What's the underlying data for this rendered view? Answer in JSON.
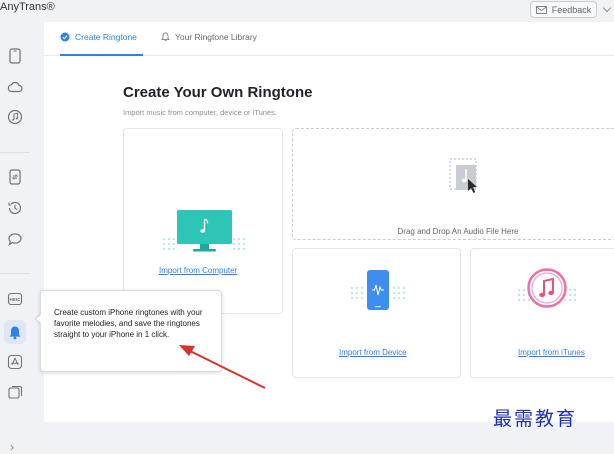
{
  "app": {
    "name": "AnyTrans®"
  },
  "header": {
    "feedback_label": "Feedback"
  },
  "sidebar": {
    "icons": [
      "device-icon",
      "cloud-icon",
      "music-icon",
      "phone-transfer-icon",
      "history-icon",
      "messages-icon",
      "heic-icon",
      "ringtone-icon",
      "app-store-icon",
      "screen-mirror-icon"
    ],
    "active": "ringtone-icon"
  },
  "tabs": [
    {
      "label": "Create Ringtone",
      "active": true
    },
    {
      "label": "Your Ringtone Library",
      "active": false
    }
  ],
  "content": {
    "title": "Create Your Own Ringtone",
    "subtitle": "Import music from computer, device or iTunes.",
    "drop_zone": "Drag and Drop An Audio File Here",
    "import_computer": "Import from Computer",
    "import_device": "Import from Device",
    "import_itunes": "Import from iTunes"
  },
  "tooltip": {
    "text": "Create custom iPhone ringtones with your favorite melodies, and save the ringtones straight to your iPhone in 1 click."
  },
  "watermark": "最需教育",
  "colors": {
    "accent": "#2f80ed",
    "teal": "#2ec4b6",
    "annotation_red": "#d9312b",
    "watermark": "#1c2fb0"
  }
}
